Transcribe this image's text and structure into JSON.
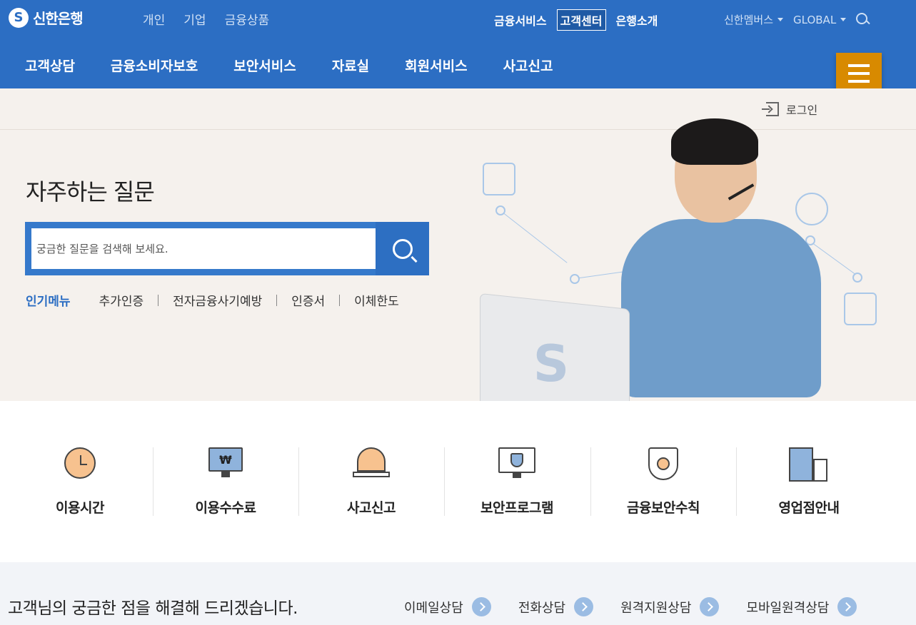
{
  "header": {
    "logo_mark": "S",
    "logo_text": "신한은행",
    "segments": [
      "개인",
      "기업",
      "금융상품"
    ],
    "utility": [
      {
        "label": "금융서비스",
        "active": false
      },
      {
        "label": "고객센터",
        "active": true
      },
      {
        "label": "은행소개",
        "active": false
      }
    ],
    "external": [
      "신한멤버스",
      "GLOBAL"
    ],
    "main_menu": [
      "고객상담",
      "금융소비자보호",
      "보안서비스",
      "자료실",
      "회원서비스",
      "사고신고"
    ],
    "colors": {
      "primary": "#2c6ec3",
      "menu_button": "#d88a00"
    }
  },
  "hero": {
    "login_label": "로그인",
    "title": "자주하는 질문",
    "search_placeholder": "궁금한 질문을 검색해 보세요.",
    "popular_label": "인기메뉴",
    "popular_items": [
      "추가인증",
      "전자금융사기예방",
      "인증서",
      "이체한도"
    ]
  },
  "quick_menu": [
    {
      "label": "이용시간",
      "icon": "clock-icon"
    },
    {
      "label": "이용수수료",
      "icon": "won-monitor-icon"
    },
    {
      "label": "사고신고",
      "icon": "siren-icon"
    },
    {
      "label": "보안프로그램",
      "icon": "secure-monitor-icon"
    },
    {
      "label": "금융보안수칙",
      "icon": "shield-icon"
    },
    {
      "label": "영업점안내",
      "icon": "building-icon"
    }
  ],
  "monitor_symbol": "₩",
  "bottom": {
    "title": "고객님의 궁금한 점을 해결해 드리겠습니다.",
    "consults": [
      "이메일상담",
      "전화상담",
      "원격지원상담",
      "모바일원격상담"
    ]
  }
}
